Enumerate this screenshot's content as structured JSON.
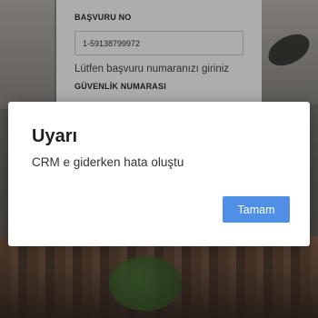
{
  "form": {
    "application_no_label": "BAŞVURU NO",
    "application_no_value": "1-59138799972",
    "application_no_hint": "Lütfen başvuru numaranızı giriniz",
    "security_no_label": "GÜVENLİK NUMARASI"
  },
  "dialog": {
    "title": "Uyarı",
    "message": "CRM e giderken hata oluştu",
    "ok_label": "Tamam"
  },
  "colors": {
    "primary_button": "#4f8fe6",
    "overlay": "rgba(0,0,0,0.32)"
  }
}
